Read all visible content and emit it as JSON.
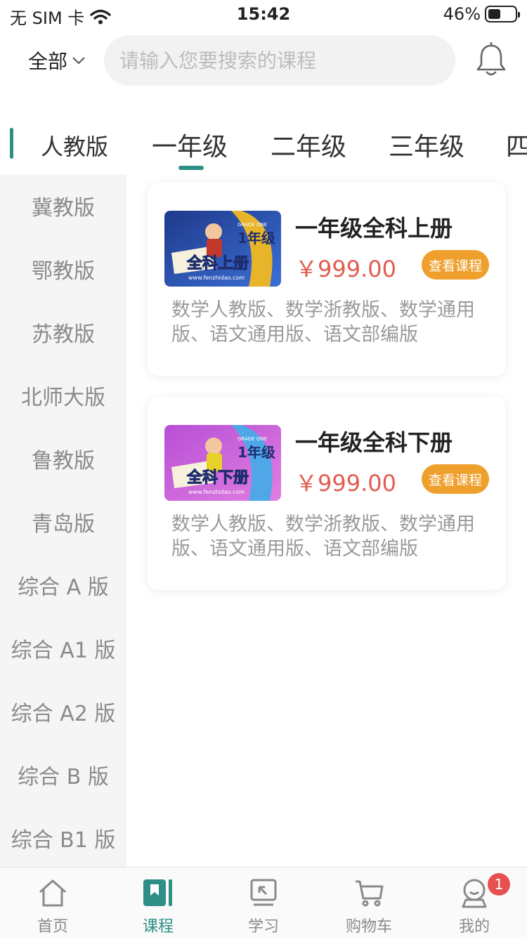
{
  "status_bar": {
    "carrier": "无 SIM 卡",
    "time": "15:42",
    "battery": "46%",
    "battery_level": 0.46
  },
  "header": {
    "scope_label": "全部",
    "search_placeholder": "请输入您要搜索的课程"
  },
  "version": {
    "selected": "人教版"
  },
  "grades": [
    "一年级",
    "二年级",
    "三年级",
    "四"
  ],
  "grade_active_index": 0,
  "sidebar": {
    "items": [
      "冀教版",
      "鄂教版",
      "苏教版",
      "北师大版",
      "鲁教版",
      "青岛版",
      "综合 A 版",
      "综合 A1 版",
      "综合 A2 版",
      "综合 B 版",
      "综合 B1 版"
    ]
  },
  "courses": [
    {
      "title": "一年级全科上册",
      "price": "￥999.00",
      "button": "查看课程",
      "desc": "数学人教版、数学浙教版、数学通用版、语文通用版、语文部编版",
      "thumb_title": "全科上册",
      "thumb_grade": "1年级",
      "thumb_tag": "GRADE ONE",
      "thumb_url": "www.fenzhidao.com"
    },
    {
      "title": "一年级全科下册",
      "price": "￥999.00",
      "button": "查看课程",
      "desc": "数学人教版、数学浙教版、数学通用版、语文通用版、语文部编版",
      "thumb_title": "全科下册",
      "thumb_grade": "1年级",
      "thumb_tag": "GRADE ONE",
      "thumb_url": "www.fenzhidao.com"
    }
  ],
  "tabbar": {
    "items": [
      {
        "label": "首页",
        "icon": "home-icon"
      },
      {
        "label": "课程",
        "icon": "course-icon"
      },
      {
        "label": "学习",
        "icon": "study-icon"
      },
      {
        "label": "购物车",
        "icon": "cart-icon"
      },
      {
        "label": "我的",
        "icon": "profile-icon"
      }
    ],
    "active_index": 1,
    "profile_badge": "1"
  },
  "colors": {
    "accent": "#2e8f87",
    "price": "#e25c4f",
    "button": "#ee9f2c",
    "badge": "#e85050"
  }
}
